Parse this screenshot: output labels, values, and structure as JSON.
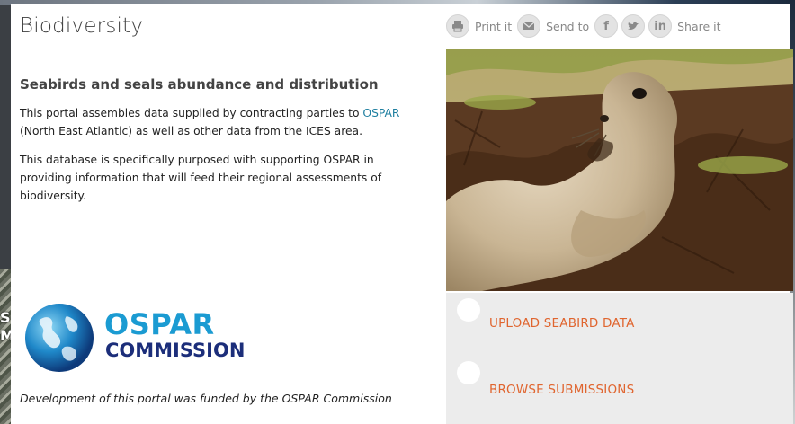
{
  "header": {
    "title": "Biodiversity"
  },
  "share": {
    "print_label": "Print it",
    "send_label": "Send to",
    "share_label": "Share it",
    "icons": [
      "printer-icon",
      "envelope-icon",
      "facebook-icon",
      "twitter-icon",
      "linkedin-icon"
    ]
  },
  "content": {
    "subtitle": "Seabirds and seals abundance and distribution",
    "para1_before": "This portal assembles data supplied by contracting parties to ",
    "para1_link": "OSPAR",
    "para1_after": " (North East Atlantic) as well as other data from the ICES area.",
    "para2": "This database is specifically purposed with supporting OSPAR in providing information that will feed their regional assessments of biodiversity."
  },
  "logo": {
    "word1": "OSPAR",
    "word2": "COMMISSION"
  },
  "credit": "Development of this portal was funded by the OSPAR Commission",
  "actions": {
    "upload_label": "UPLOAD SEABIRD DATA",
    "browse_label": "BROWSE SUBMISSIONS"
  },
  "background": {
    "left_fragment": "S M"
  },
  "colors": {
    "link": "#1f7fa0",
    "action_text": "#e0652f",
    "action_bg": "#ececec",
    "logo_blue": "#1b9bd2",
    "logo_navy": "#1c2e7a"
  }
}
